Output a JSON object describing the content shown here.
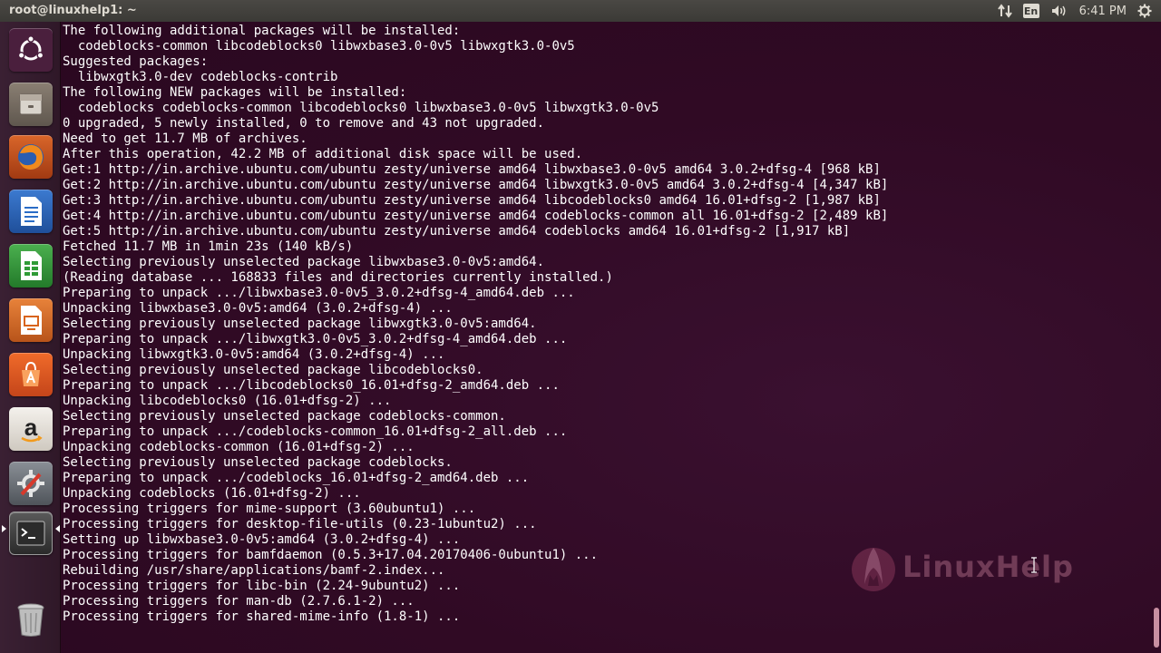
{
  "window": {
    "title": "root@linuxhelp1: ~"
  },
  "top_panel": {
    "keyboard_layout": "En",
    "clock": "6:41 PM",
    "icons": [
      "network-transfer-icon",
      "keyboard-icon",
      "volume-icon",
      "system-gear-icon"
    ]
  },
  "launcher": {
    "items": [
      {
        "name": "ubuntu-dash-icon"
      },
      {
        "name": "files-icon"
      },
      {
        "name": "firefox-icon"
      },
      {
        "name": "libreoffice-writer-icon"
      },
      {
        "name": "libreoffice-calc-icon"
      },
      {
        "name": "libreoffice-impress-icon"
      },
      {
        "name": "ubuntu-software-icon"
      },
      {
        "name": "amazon-icon"
      },
      {
        "name": "system-settings-icon"
      },
      {
        "name": "terminal-icon"
      },
      {
        "name": "trash-icon"
      }
    ]
  },
  "terminal": {
    "lines": [
      "The following additional packages will be installed:",
      "  codeblocks-common libcodeblocks0 libwxbase3.0-0v5 libwxgtk3.0-0v5",
      "Suggested packages:",
      "  libwxgtk3.0-dev codeblocks-contrib",
      "The following NEW packages will be installed:",
      "  codeblocks codeblocks-common libcodeblocks0 libwxbase3.0-0v5 libwxgtk3.0-0v5",
      "0 upgraded, 5 newly installed, 0 to remove and 43 not upgraded.",
      "Need to get 11.7 MB of archives.",
      "After this operation, 42.2 MB of additional disk space will be used.",
      "Get:1 http://in.archive.ubuntu.com/ubuntu zesty/universe amd64 libwxbase3.0-0v5 amd64 3.0.2+dfsg-4 [968 kB]",
      "Get:2 http://in.archive.ubuntu.com/ubuntu zesty/universe amd64 libwxgtk3.0-0v5 amd64 3.0.2+dfsg-4 [4,347 kB]",
      "Get:3 http://in.archive.ubuntu.com/ubuntu zesty/universe amd64 libcodeblocks0 amd64 16.01+dfsg-2 [1,987 kB]",
      "Get:4 http://in.archive.ubuntu.com/ubuntu zesty/universe amd64 codeblocks-common all 16.01+dfsg-2 [2,489 kB]",
      "Get:5 http://in.archive.ubuntu.com/ubuntu zesty/universe amd64 codeblocks amd64 16.01+dfsg-2 [1,917 kB]",
      "Fetched 11.7 MB in 1min 23s (140 kB/s)",
      "Selecting previously unselected package libwxbase3.0-0v5:amd64.",
      "(Reading database ... 168833 files and directories currently installed.)",
      "Preparing to unpack .../libwxbase3.0-0v5_3.0.2+dfsg-4_amd64.deb ...",
      "Unpacking libwxbase3.0-0v5:amd64 (3.0.2+dfsg-4) ...",
      "Selecting previously unselected package libwxgtk3.0-0v5:amd64.",
      "Preparing to unpack .../libwxgtk3.0-0v5_3.0.2+dfsg-4_amd64.deb ...",
      "Unpacking libwxgtk3.0-0v5:amd64 (3.0.2+dfsg-4) ...",
      "Selecting previously unselected package libcodeblocks0.",
      "Preparing to unpack .../libcodeblocks0_16.01+dfsg-2_amd64.deb ...",
      "Unpacking libcodeblocks0 (16.01+dfsg-2) ...",
      "Selecting previously unselected package codeblocks-common.",
      "Preparing to unpack .../codeblocks-common_16.01+dfsg-2_all.deb ...",
      "Unpacking codeblocks-common (16.01+dfsg-2) ...",
      "Selecting previously unselected package codeblocks.",
      "Preparing to unpack .../codeblocks_16.01+dfsg-2_amd64.deb ...",
      "Unpacking codeblocks (16.01+dfsg-2) ...",
      "Processing triggers for mime-support (3.60ubuntu1) ...",
      "Processing triggers for desktop-file-utils (0.23-1ubuntu2) ...",
      "Setting up libwxbase3.0-0v5:amd64 (3.0.2+dfsg-4) ...",
      "Processing triggers for bamfdaemon (0.5.3+17.04.20170406-0ubuntu1) ...",
      "Rebuilding /usr/share/applications/bamf-2.index...",
      "Processing triggers for libc-bin (2.24-9ubuntu2) ...",
      "Processing triggers for man-db (2.7.6.1-2) ...",
      "Processing triggers for shared-mime-info (1.8-1) ..."
    ]
  },
  "watermark": {
    "text": "LinuxHelp"
  },
  "colors": {
    "terminal_bg": "#300a24",
    "terminal_fg": "#ffffff",
    "panel_bg": "#3b3a36",
    "launcher_bg": "#3a2033"
  }
}
